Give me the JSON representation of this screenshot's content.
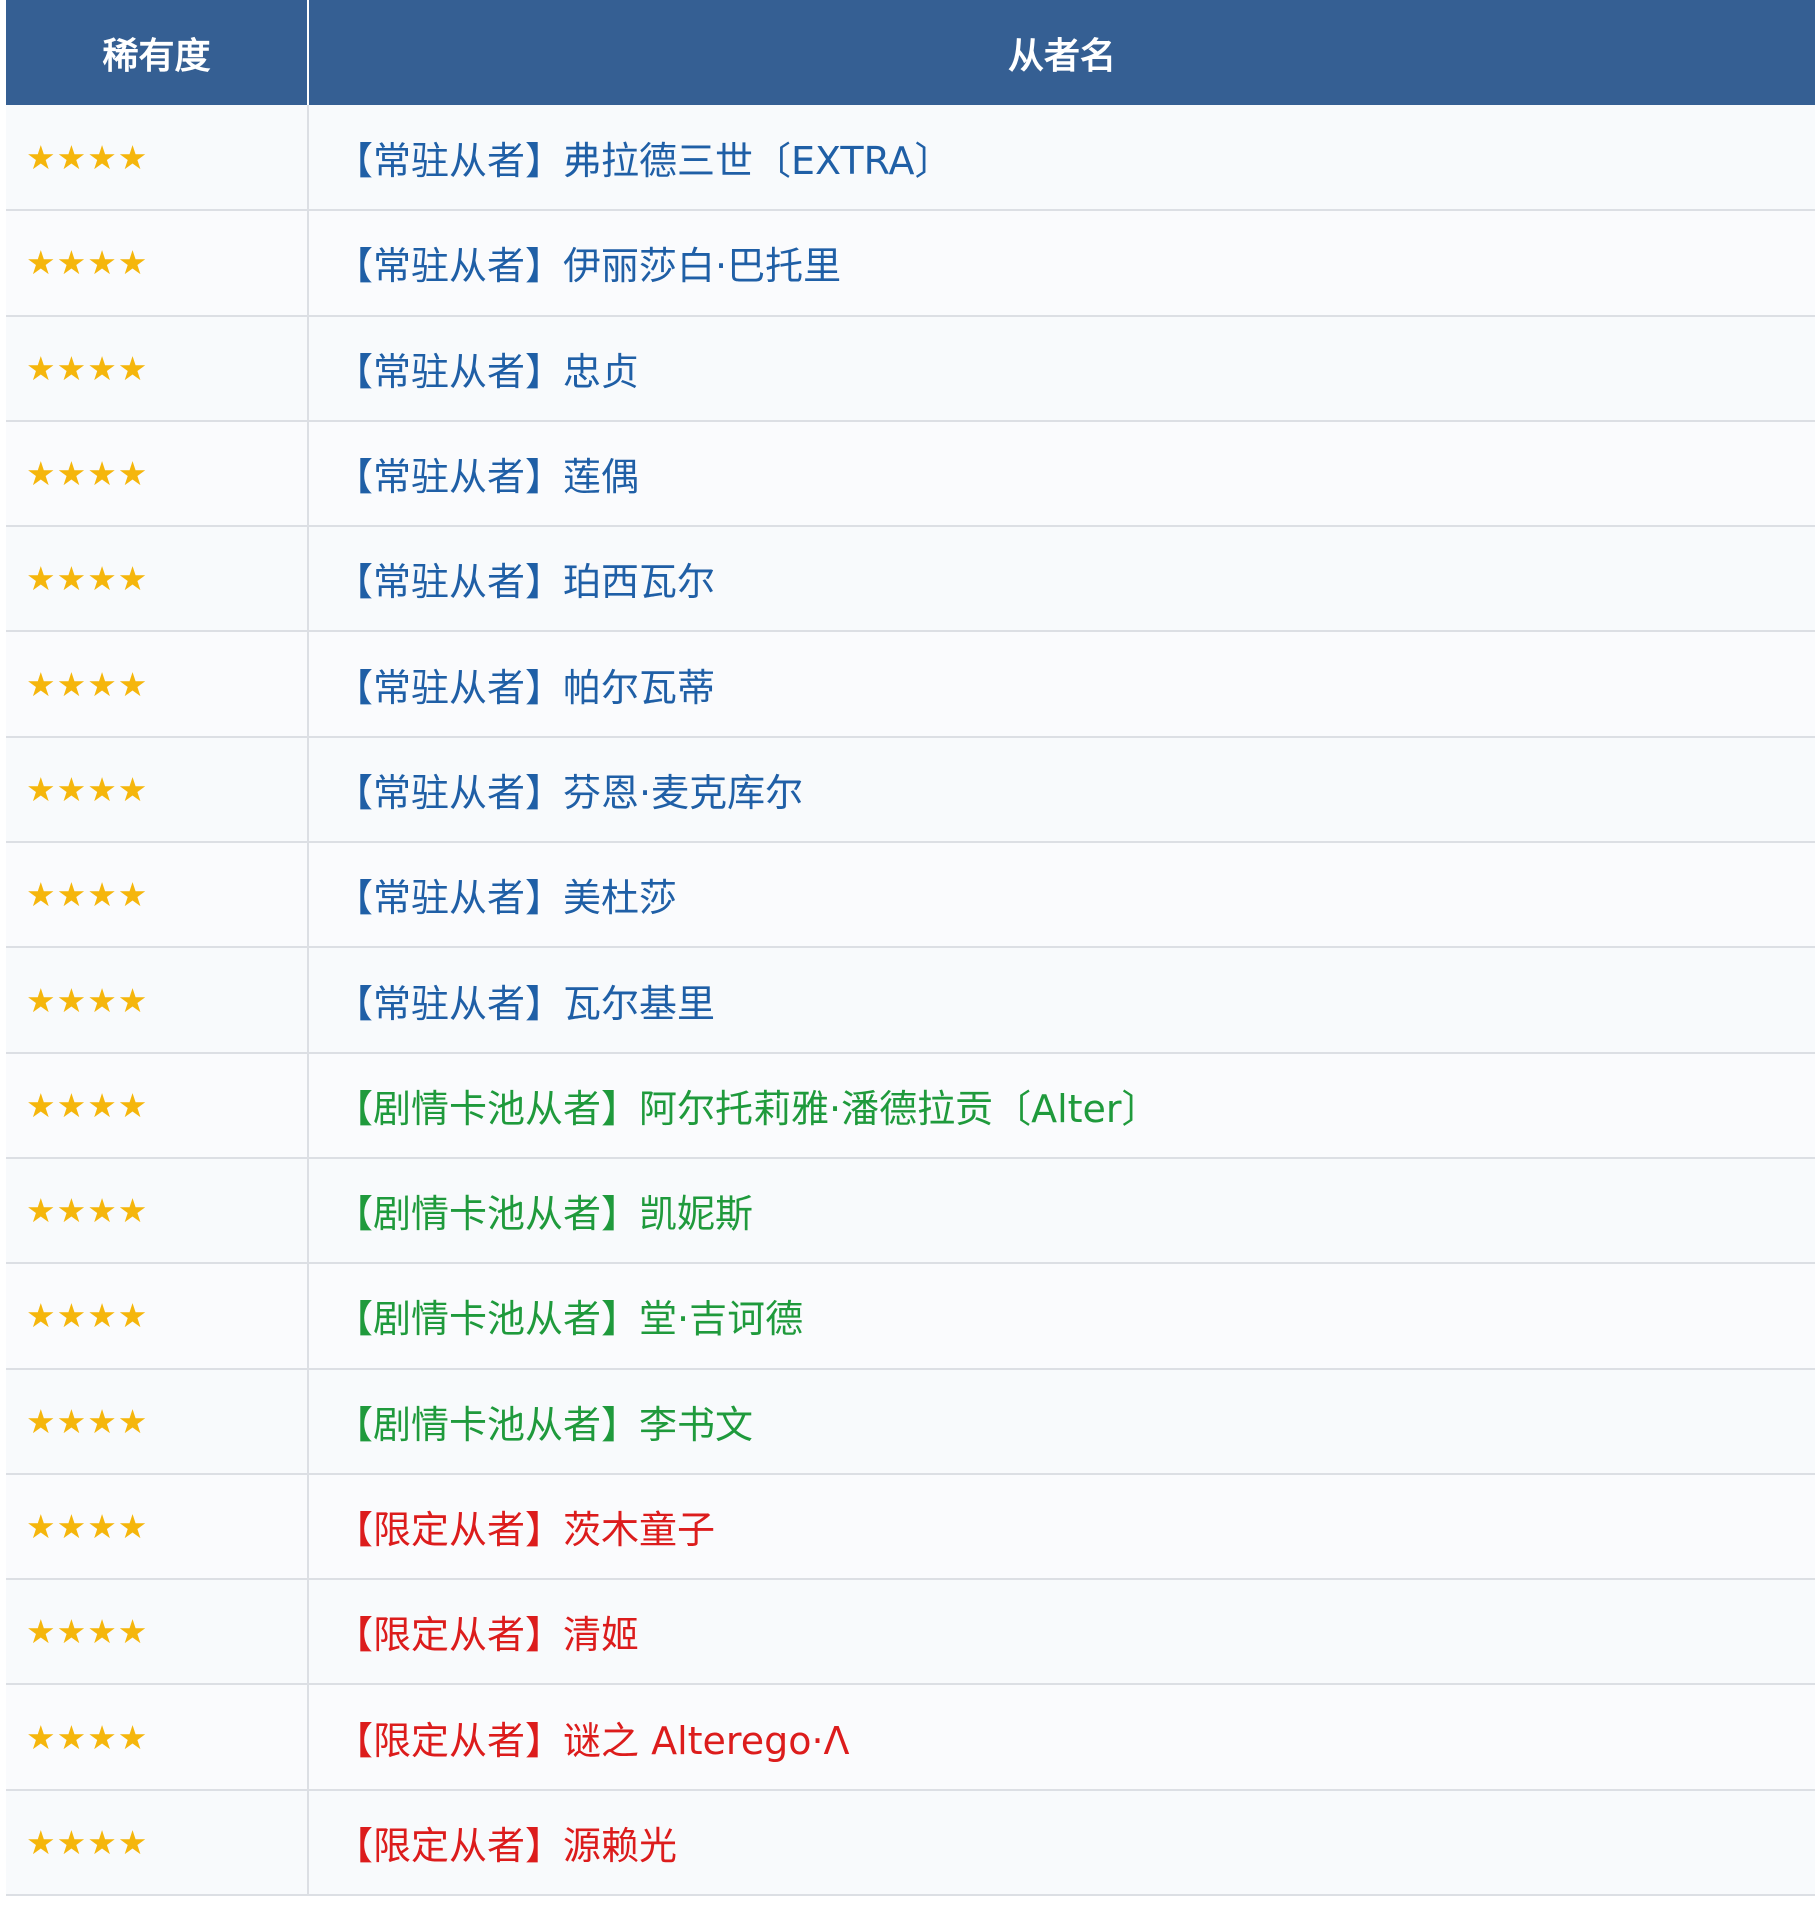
{
  "table": {
    "headers": {
      "rarity": "稀有度",
      "servant": "从者名"
    },
    "colors": {
      "header_bg": "#355f93",
      "star": "#f5b60c",
      "permanent": "#1f5fa6",
      "story": "#1f9a3c",
      "limited": "#dc1c1c"
    },
    "rows": [
      {
        "stars": 4,
        "category": "permanent",
        "name": "【常驻从者】弗拉德三世〔EXTRA〕"
      },
      {
        "stars": 4,
        "category": "permanent",
        "name": "【常驻从者】伊丽莎白·巴托里"
      },
      {
        "stars": 4,
        "category": "permanent",
        "name": "【常驻从者】忠贞"
      },
      {
        "stars": 4,
        "category": "permanent",
        "name": "【常驻从者】莲偶"
      },
      {
        "stars": 4,
        "category": "permanent",
        "name": "【常驻从者】珀西瓦尔"
      },
      {
        "stars": 4,
        "category": "permanent",
        "name": "【常驻从者】帕尔瓦蒂"
      },
      {
        "stars": 4,
        "category": "permanent",
        "name": "【常驻从者】芬恩·麦克库尔"
      },
      {
        "stars": 4,
        "category": "permanent",
        "name": "【常驻从者】美杜莎"
      },
      {
        "stars": 4,
        "category": "permanent",
        "name": "【常驻从者】瓦尔基里"
      },
      {
        "stars": 4,
        "category": "story",
        "name": "【剧情卡池从者】阿尔托莉雅·潘德拉贡〔Alter〕"
      },
      {
        "stars": 4,
        "category": "story",
        "name": "【剧情卡池从者】凯妮斯"
      },
      {
        "stars": 4,
        "category": "story",
        "name": "【剧情卡池从者】堂·吉诃德"
      },
      {
        "stars": 4,
        "category": "story",
        "name": "【剧情卡池从者】李书文"
      },
      {
        "stars": 4,
        "category": "limited",
        "name": "【限定从者】茨木童子"
      },
      {
        "stars": 4,
        "category": "limited",
        "name": "【限定从者】清姬"
      },
      {
        "stars": 4,
        "category": "limited",
        "name": "【限定从者】谜之 Alterego·Λ"
      },
      {
        "stars": 4,
        "category": "limited",
        "name": "【限定从者】源赖光"
      }
    ]
  }
}
